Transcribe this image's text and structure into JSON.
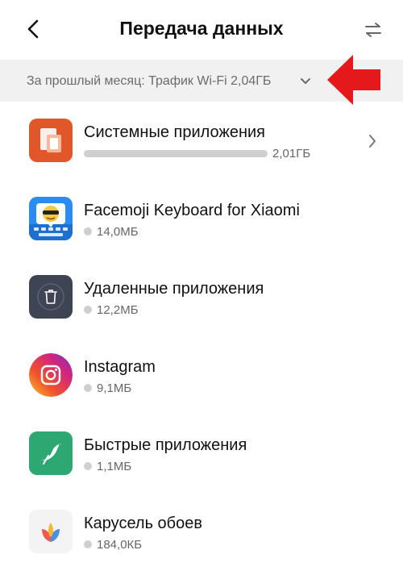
{
  "header": {
    "title": "Передача данных",
    "back_icon": "back-arrow-icon",
    "swap_icon": "swap-arrows-icon"
  },
  "filter": {
    "label": "За прошлый месяц: Трафик Wi-Fi 2,04ГБ",
    "chevron_icon": "chevron-down-icon",
    "annotation_color": "#e5191c"
  },
  "apps": [
    {
      "name": "Системные приложения",
      "usage": "2,01ГБ",
      "icon": "system-apps-icon",
      "show_bar": true,
      "has_chevron": true
    },
    {
      "name": "Facemoji Keyboard for Xiaomi",
      "usage": "14,0МБ",
      "icon": "facemoji-keyboard-icon"
    },
    {
      "name": "Удаленные приложения",
      "usage": "12,2МБ",
      "icon": "deleted-apps-trash-icon"
    },
    {
      "name": "Instagram",
      "usage": "9,1МБ",
      "icon": "instagram-icon"
    },
    {
      "name": "Быстрые приложения",
      "usage": "1,1МБ",
      "icon": "quick-apps-icon"
    },
    {
      "name": "Карусель обоев",
      "usage": "184,0КБ",
      "icon": "wallpaper-carousel-icon"
    }
  ],
  "colors": {
    "bar_gray": "#cfcfcf",
    "filter_bg": "#f1f1f1",
    "system_icon_bg": "#e0572a",
    "facemoji_icon_bg": "#2a8cf0",
    "deleted_icon_bg": "#3e4454",
    "quick_icon_bg": "#2ea872"
  }
}
